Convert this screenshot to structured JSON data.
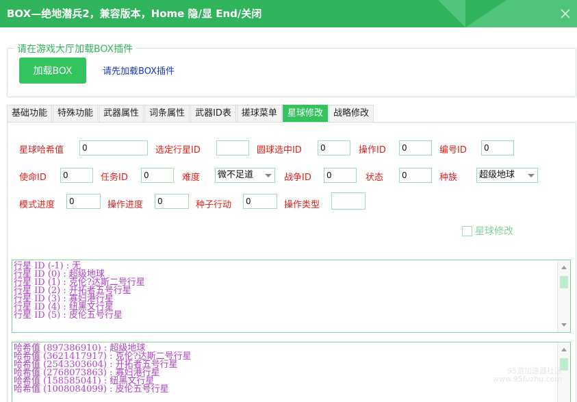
{
  "window": {
    "title": "BOX—绝地潜兵2，兼容版本，Home 隐/显  End/关闭",
    "close_icon": "close-icon"
  },
  "loader": {
    "legend": "请在游戏大厅加载BOX插件",
    "button_label": "加载BOX",
    "hint": "请先加载BOX插件"
  },
  "tabs": [
    {
      "label": "基础功能",
      "active": false
    },
    {
      "label": "特殊功能",
      "active": false
    },
    {
      "label": "武器属性",
      "active": false
    },
    {
      "label": "词条属性",
      "active": false
    },
    {
      "label": "武器ID表",
      "active": false
    },
    {
      "label": "搓球菜单",
      "active": false
    },
    {
      "label": "星球修改",
      "active": true
    },
    {
      "label": "战略修改",
      "active": false
    }
  ],
  "form": {
    "planet_hash": {
      "label": "星球哈希值",
      "value": "0"
    },
    "selected_planet_id": {
      "label": "选定行星ID",
      "value": ""
    },
    "circle_selected_id": {
      "label": "圆球选中ID",
      "value": "0"
    },
    "operation_id": {
      "label": "操作ID",
      "value": "0"
    },
    "number_id": {
      "label": "编号ID",
      "value": "0"
    },
    "mission_id": {
      "label": "使命ID",
      "value": "0"
    },
    "task_id": {
      "label": "任务ID",
      "value": "0"
    },
    "difficulty": {
      "label": "难度",
      "value": "微不足道"
    },
    "war_id": {
      "label": "战争ID",
      "value": "0"
    },
    "status": {
      "label": "状态",
      "value": "0"
    },
    "race": {
      "label": "种族",
      "value": "超级地球"
    },
    "mode_progress": {
      "label": "模式进度",
      "value": "0"
    },
    "operation_progress": {
      "label": "操作进度",
      "value": "0"
    },
    "seed_action": {
      "label": "种子行动",
      "value": "0"
    },
    "operation_type": {
      "label": "操作类型",
      "value": ""
    },
    "planet_modify_checkbox": {
      "label": "星球修改",
      "checked": false
    }
  },
  "planet_id_list": [
    "行星 ID (-1) : 无",
    "行星 ID (0) : 超级地球",
    "行星 ID (1) : 克伦?达斯二号行星",
    "行星 ID (2) : 开拓者五号行星",
    "行星 ID (3) : 寡妇港行星",
    "行星 ID (4) : 纽黑文行星",
    "行星 ID (5) : 皮伦五号行星"
  ],
  "hash_list": [
    "哈希值 (897386910) : 超级地球",
    "哈希值 (3621417917) : 克伦?达斯二号行星",
    "哈希值 (2543303604) : 开拓者五号行星",
    "哈希值 (2768073863) : 寡妇港行星",
    "哈希值 (158585041) : 纽黑文行星",
    "哈希值 (1008084099) : 皮伦五号行星"
  ],
  "watermark": {
    "line1": "95游加速器社区",
    "line2": "www.95fuzhu.com"
  },
  "colors": {
    "accent": "#33c35f",
    "label_red": "#e0211c",
    "list_text": "#b440cc",
    "hint_blue": "#1a35c9"
  }
}
